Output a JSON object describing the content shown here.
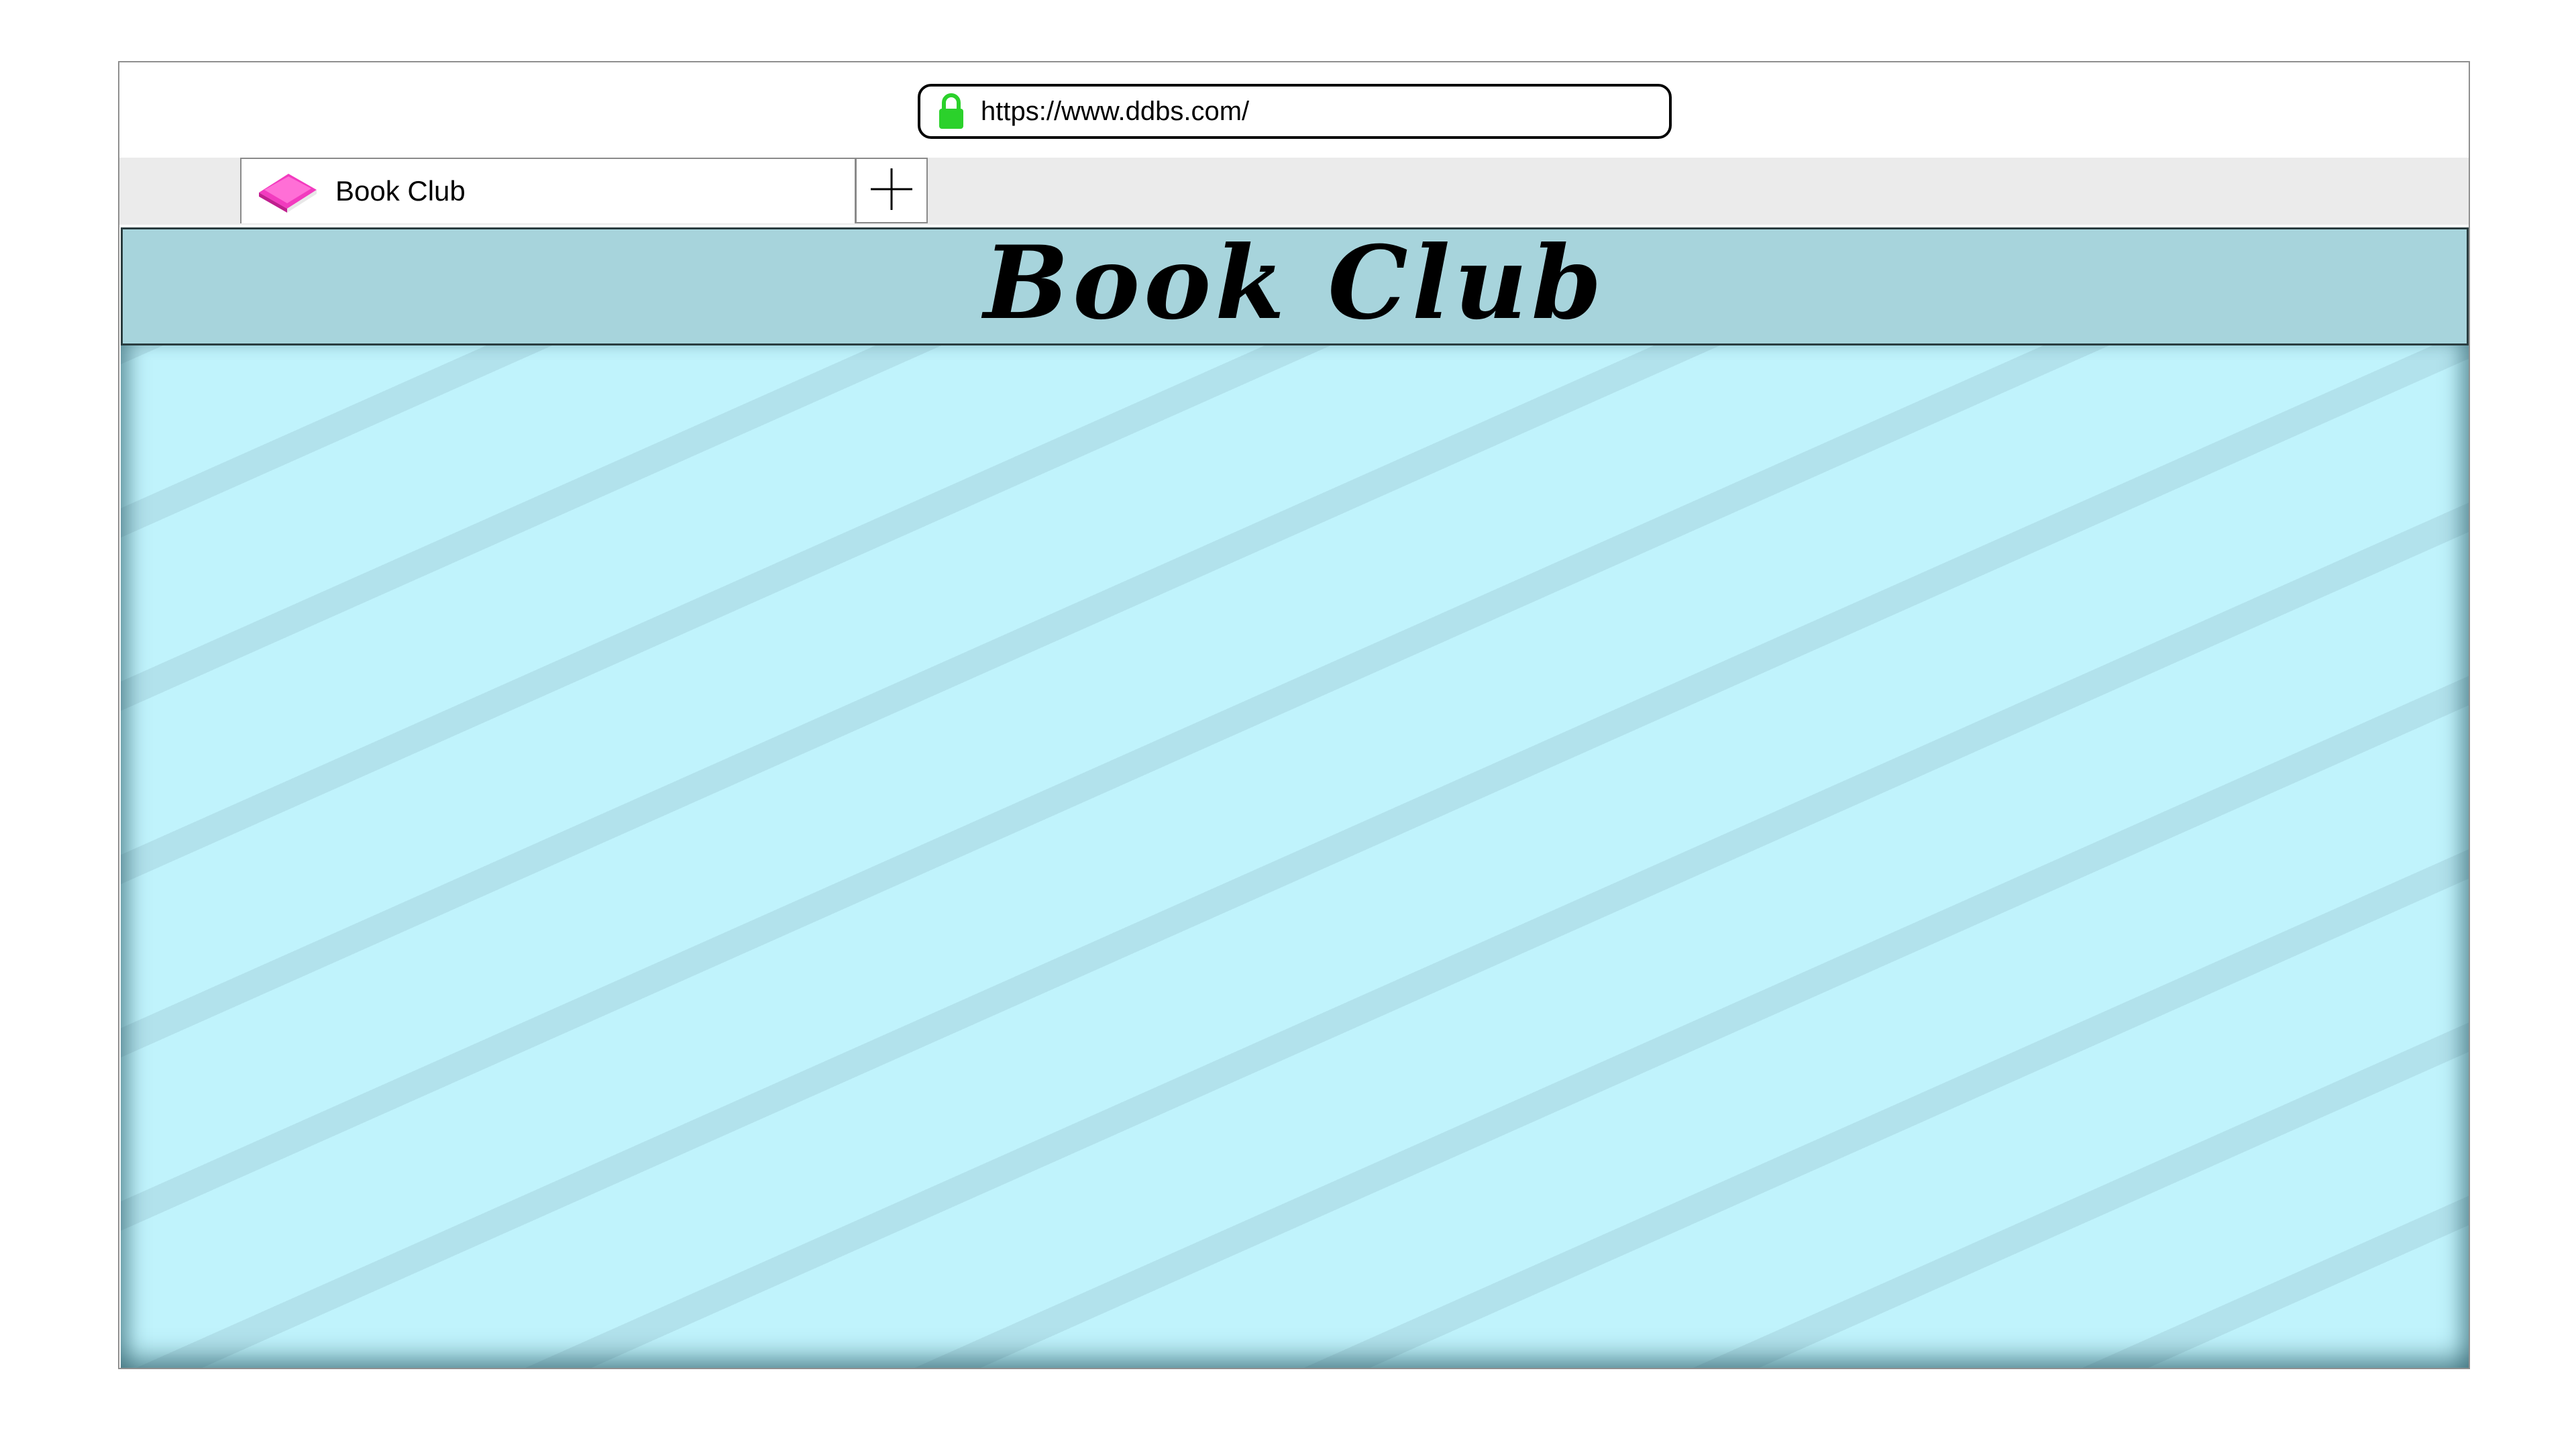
{
  "browser": {
    "url": "https://www.ddbs.com/",
    "lock_icon": "lock-icon",
    "lock_color": "#2bd12b",
    "tabs": [
      {
        "label": "Book Club",
        "icon": "book-icon",
        "icon_color": "#f23bbf"
      }
    ],
    "new_tab_icon": "plus-icon"
  },
  "page": {
    "title": "Book Club",
    "header_color": "#a7d4dc",
    "body_color": "#c0f3fc",
    "stripe_color": "#b2e2ec"
  }
}
